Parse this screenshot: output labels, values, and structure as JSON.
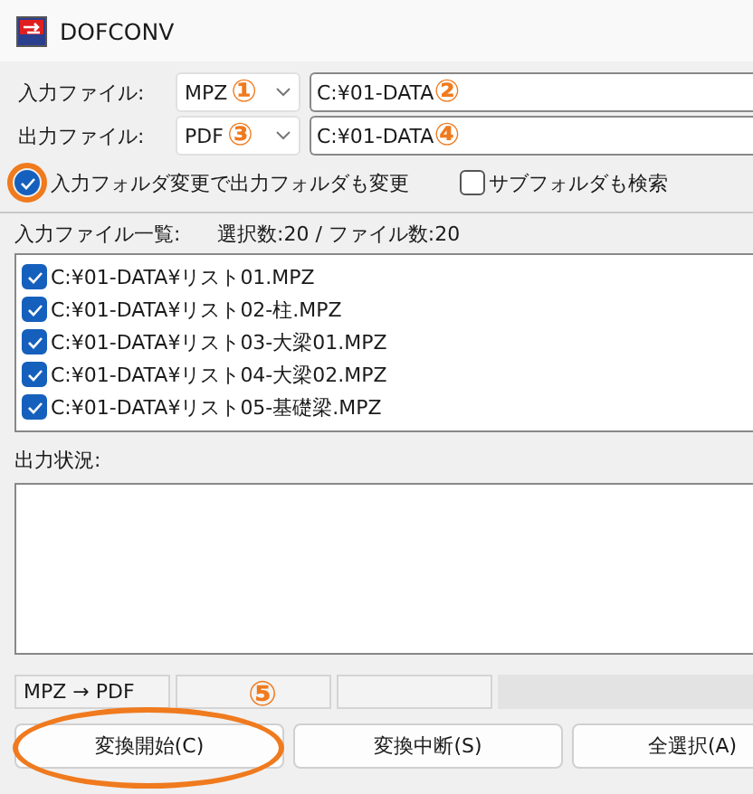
{
  "window": {
    "title": "DOFCONV"
  },
  "input_file": {
    "label": "入力ファイル:",
    "format": "MPZ",
    "format_marker": "①",
    "path": "C:¥01-DATA",
    "path_marker": "②"
  },
  "output_file": {
    "label": "出力ファイル:",
    "format": "PDF",
    "format_marker": "③",
    "path": "C:¥01-DATA",
    "path_marker": "④"
  },
  "options": [
    {
      "label": "入力フォルダ変更で出力フォルダも変更",
      "checked": true,
      "highlighted": true
    },
    {
      "label": "サブフォルダも検索",
      "checked": false,
      "highlighted": false
    }
  ],
  "file_list": {
    "label": "入力ファイル一覧:",
    "summary": "選択数:20 / ファイル数:20",
    "items": [
      {
        "name": "C:¥01-DATA¥リスト01.MPZ",
        "checked": true
      },
      {
        "name": "C:¥01-DATA¥リスト02-柱.MPZ",
        "checked": true
      },
      {
        "name": "C:¥01-DATA¥リスト03-大梁01.MPZ",
        "checked": true
      },
      {
        "name": "C:¥01-DATA¥リスト04-大梁02.MPZ",
        "checked": true
      },
      {
        "name": "C:¥01-DATA¥リスト05-基礎梁.MPZ",
        "checked": true
      }
    ]
  },
  "output_status": {
    "label": "出力状況:"
  },
  "status_bar": {
    "conversion": "MPZ → PDF",
    "marker": "⑤"
  },
  "buttons": [
    {
      "label": "変換開始(C)",
      "highlighted": true
    },
    {
      "label": "変換中断(S)",
      "highlighted": false
    },
    {
      "label": "全選択(A)",
      "highlighted": false
    }
  ]
}
